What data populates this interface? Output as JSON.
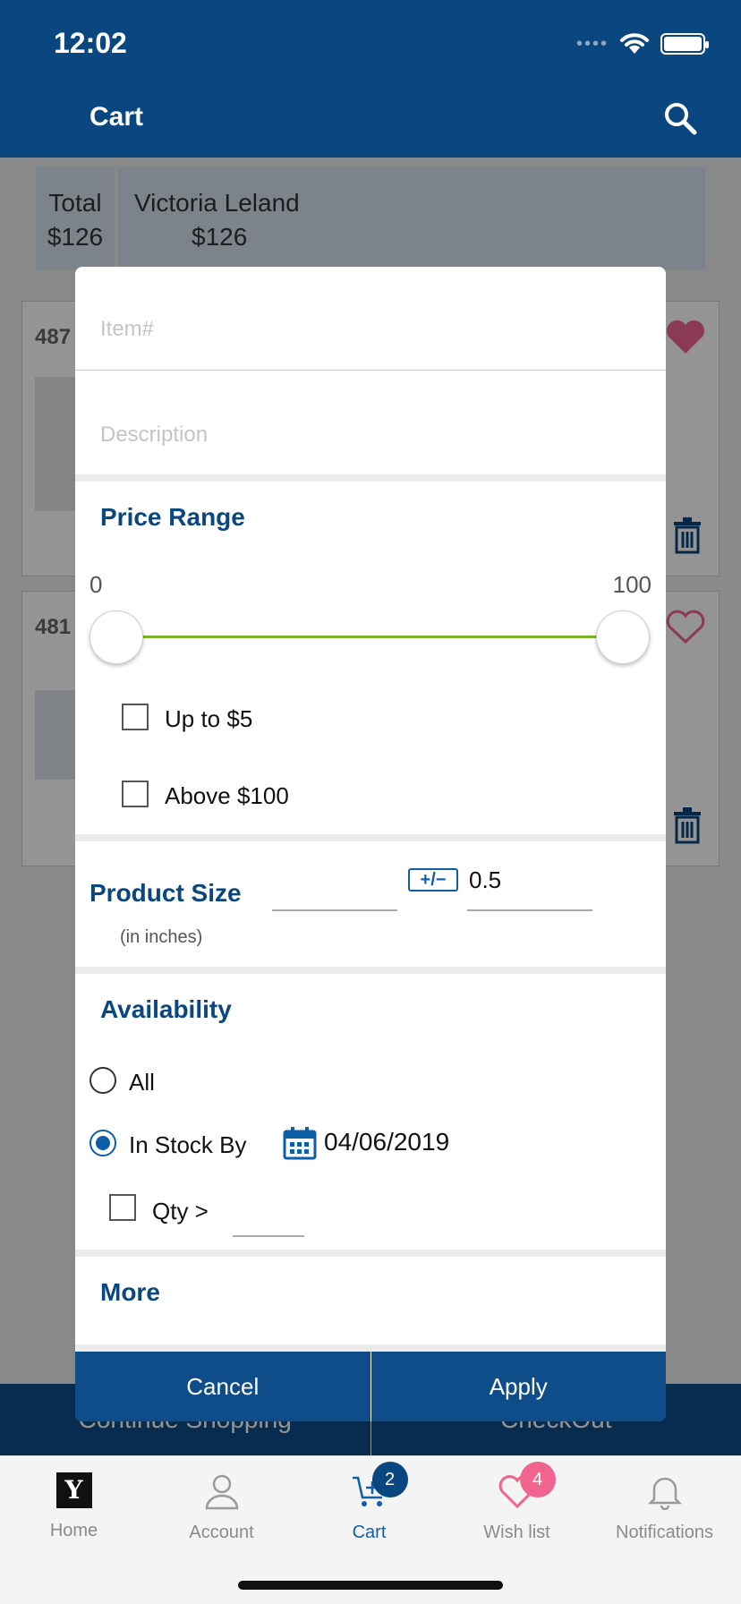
{
  "status_bar": {
    "time": "12:02"
  },
  "header": {
    "title": "Cart",
    "search_icon": "search-icon"
  },
  "summary": {
    "total_label": "Total",
    "total_amount": "$126",
    "user_name": "Victoria Leland",
    "user_amount": "$126"
  },
  "items": [
    {
      "number": "487",
      "heart": "filled"
    },
    {
      "number": "481",
      "heart": "outline"
    }
  ],
  "bottom_actions": {
    "continue": "Continue Shopping",
    "checkout": "CheckOut"
  },
  "filter": {
    "item_placeholder": "Item#",
    "description_placeholder": "Description",
    "price_range": {
      "title": "Price Range",
      "min": "0",
      "max": "100"
    },
    "price_options": [
      "Up to $5",
      "Above $100"
    ],
    "product_size": {
      "title": "Product Size",
      "note": "(in inches)",
      "tolerance": "0.5",
      "tolerance_icon": "+/−"
    },
    "availability": {
      "title": "Availability",
      "all_label": "All",
      "in_stock_label": "In Stock By",
      "date": "04/06/2019",
      "qty_label": "Qty >"
    },
    "more_title": "More",
    "cancel": "Cancel",
    "apply": "Apply"
  },
  "tabbar": {
    "home": "Home",
    "account": "Account",
    "cart": "Cart",
    "cart_badge": "2",
    "wishlist": "Wish list",
    "wishlist_badge": "4",
    "notifications": "Notifications",
    "home_logo": "Y"
  },
  "colors": {
    "brand": "#0a467f",
    "accent": "#0f5ea8",
    "slider": "#7ab52a",
    "heart": "#f0648f"
  }
}
